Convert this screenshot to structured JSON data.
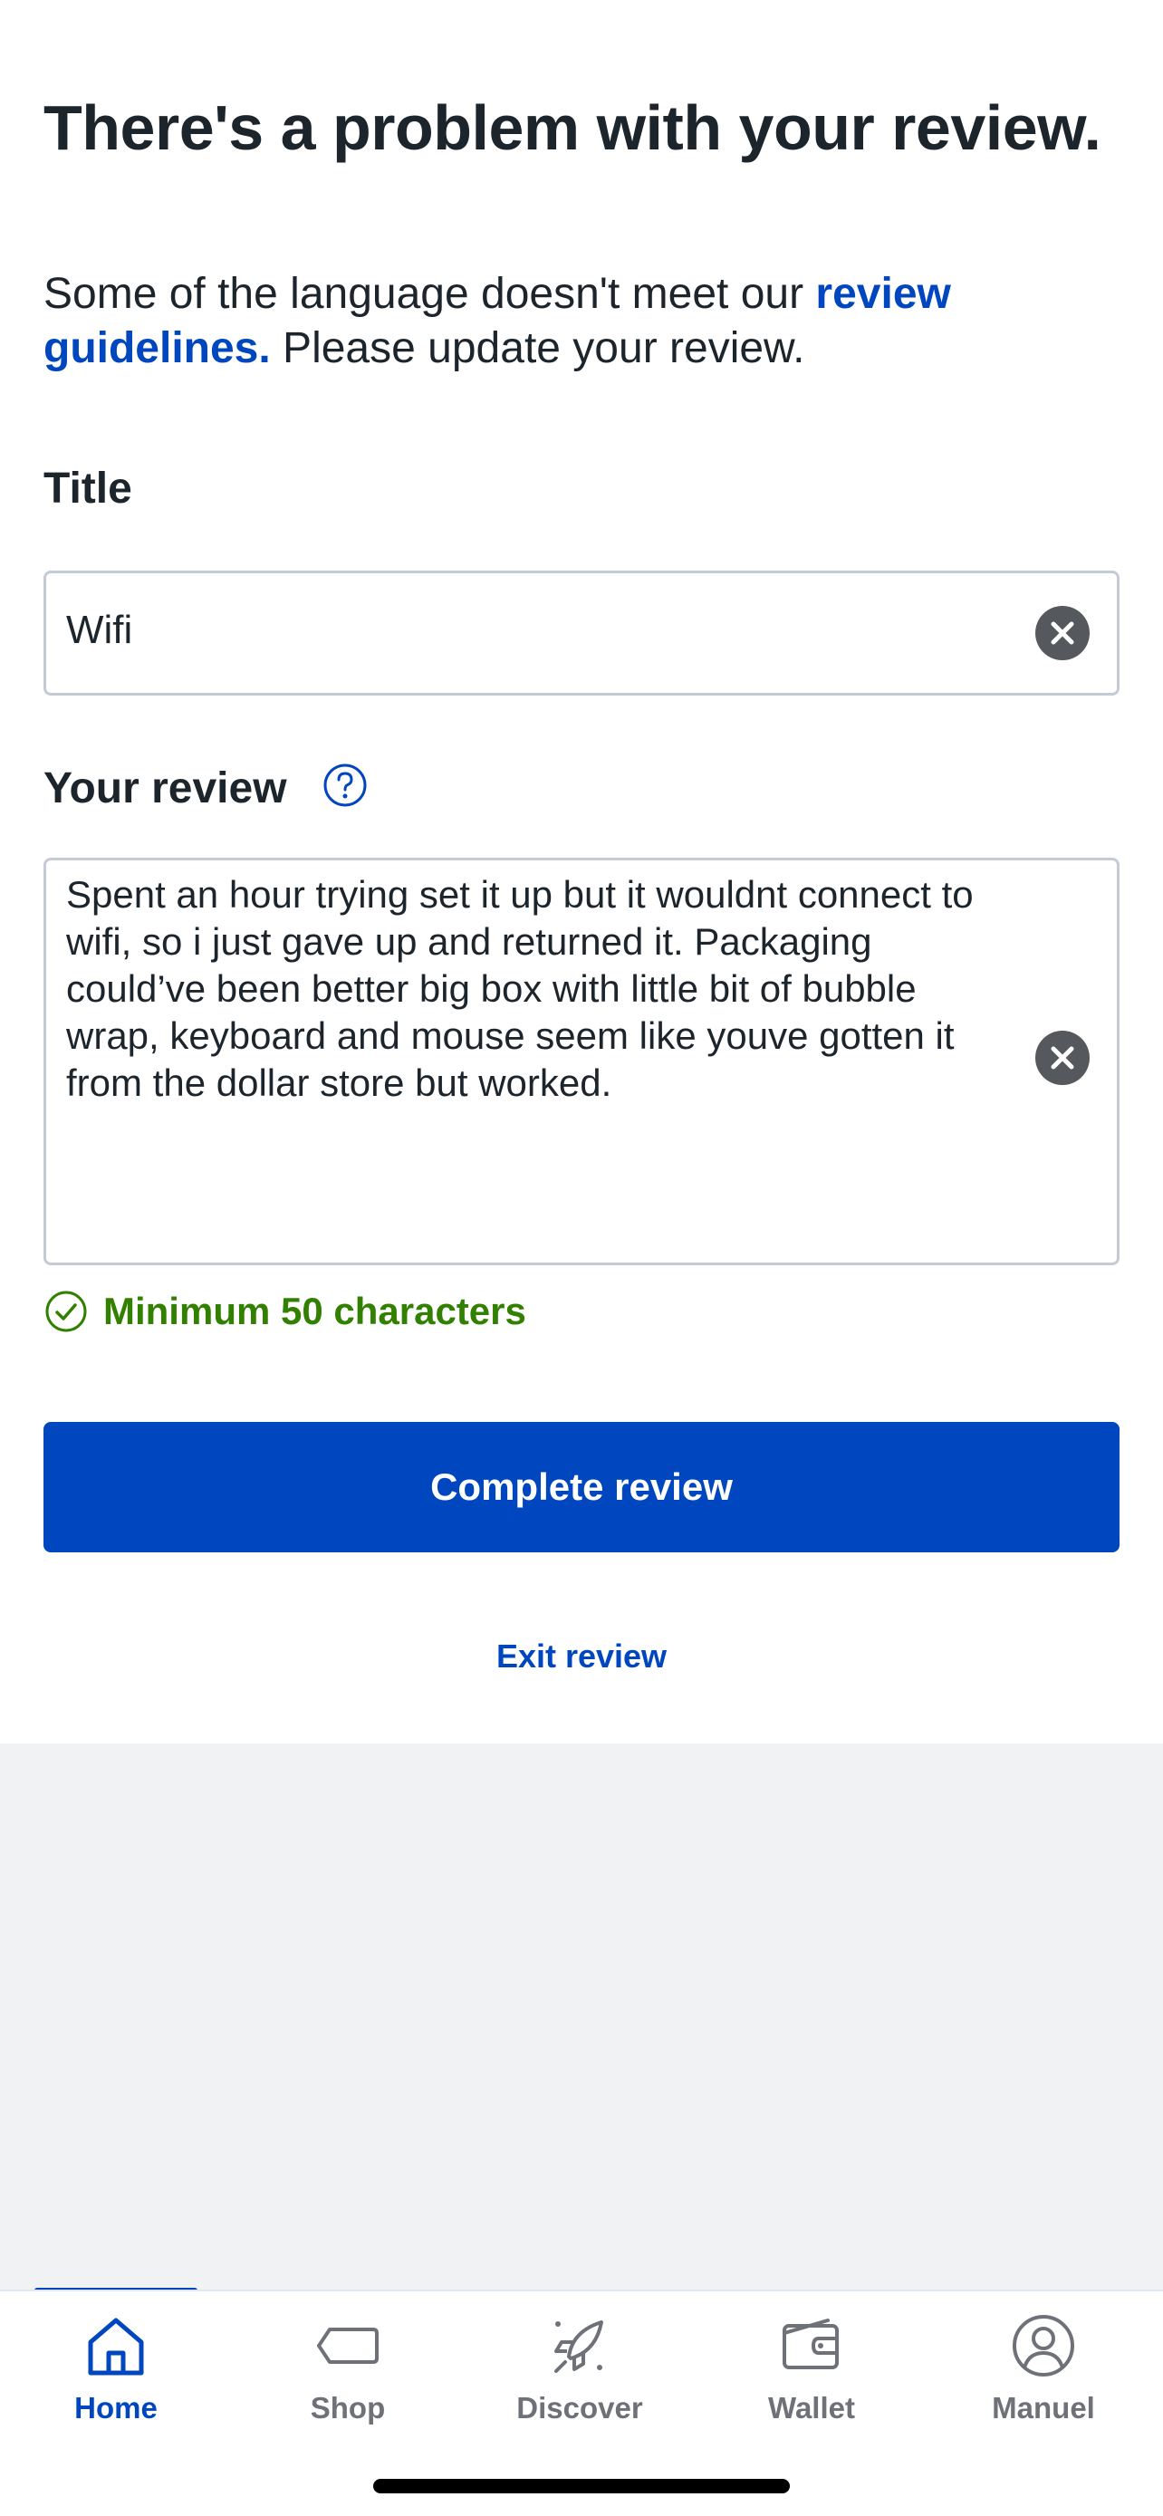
{
  "header": {
    "title": "There's a problem with your review.",
    "subtext_before": "Some of the language doesn't meet our ",
    "subtext_link": "review guidelines.",
    "subtext_after": " Please update your review."
  },
  "title_field": {
    "label": "Title",
    "value": "Wifi"
  },
  "review_field": {
    "label": "Your review",
    "value": "Spent an hour trying set it up but it wouldnt connect to wifi, so i just gave up and returned it. Packaging could’ve been better big box with little bit of bubble wrap, keyboard and mouse seem like youve gotten it from the dollar store but worked."
  },
  "validation": {
    "min_text": "Minimum 50 characters"
  },
  "actions": {
    "complete_label": "Complete review",
    "exit_label": "Exit review"
  },
  "tabbar": {
    "items": [
      {
        "label": "Home",
        "icon": "home-icon",
        "active": true
      },
      {
        "label": "Shop",
        "icon": "tag-icon",
        "active": false
      },
      {
        "label": "Discover",
        "icon": "rocket-icon",
        "active": false
      },
      {
        "label": "Wallet",
        "icon": "wallet-icon",
        "active": false
      },
      {
        "label": "Manuel",
        "icon": "user-icon",
        "active": false
      }
    ]
  },
  "colors": {
    "brand_blue": "#0046be",
    "success_green": "#318000",
    "text_dark": "#1d252c"
  }
}
